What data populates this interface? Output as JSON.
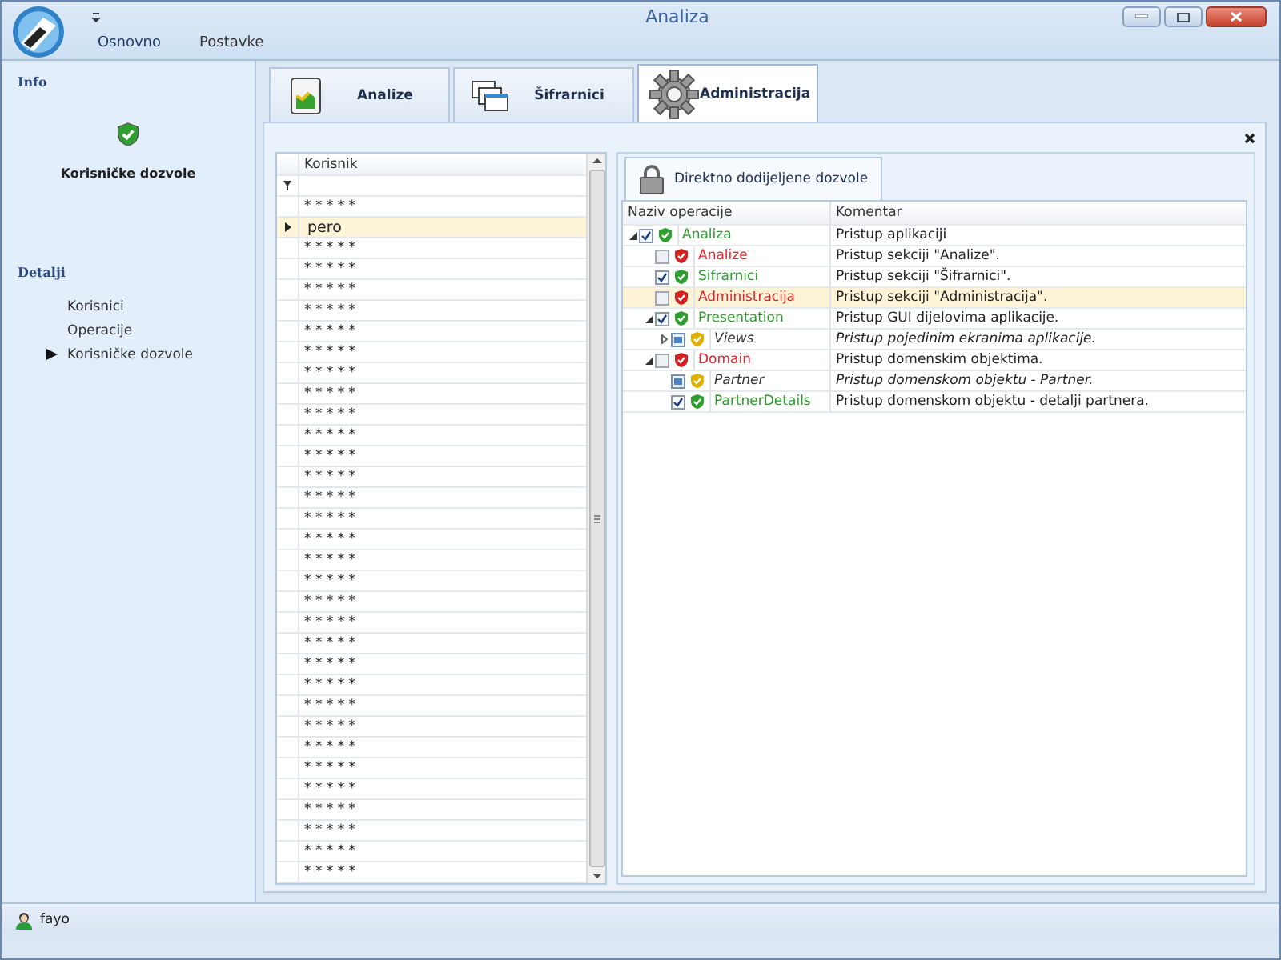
{
  "window": {
    "title": "Analiza"
  },
  "ribbon_tabs": [
    {
      "label": "Osnovno",
      "selected": true
    },
    {
      "label": "Postavke",
      "selected": false
    }
  ],
  "sidebar": {
    "info_heading": "Info",
    "info_label": "Korisničke dozvole",
    "details_heading": "Detalji",
    "items": [
      {
        "label": "Korisnici",
        "selected": false
      },
      {
        "label": "Operacije",
        "selected": false
      },
      {
        "label": "Korisničke dozvole",
        "selected": true
      }
    ]
  },
  "tabs": [
    {
      "label": "Analize",
      "kind": "analize",
      "selected": false
    },
    {
      "label": "Šifrarnici",
      "kind": "sifrarnici",
      "selected": false
    },
    {
      "label": "Administracija",
      "kind": "administracija",
      "selected": true
    }
  ],
  "users": {
    "column": "Korisnik",
    "rows": [
      {
        "name": "* * * * *",
        "selected": false
      },
      {
        "name": "pero",
        "selected": true
      },
      {
        "name": "* * * * *",
        "selected": false
      },
      {
        "name": "* * * * *",
        "selected": false
      },
      {
        "name": "* * * * *",
        "selected": false
      },
      {
        "name": "* * * * *",
        "selected": false
      },
      {
        "name": "* * * * *",
        "selected": false
      },
      {
        "name": "* * * * *",
        "selected": false
      },
      {
        "name": "* * * * *",
        "selected": false
      },
      {
        "name": "* * * * *",
        "selected": false
      },
      {
        "name": "* * * * *",
        "selected": false
      },
      {
        "name": "* * * * *",
        "selected": false
      },
      {
        "name": "* * * * *",
        "selected": false
      },
      {
        "name": "* * * * *",
        "selected": false
      },
      {
        "name": "* * * * *",
        "selected": false
      },
      {
        "name": "* * * * *",
        "selected": false
      },
      {
        "name": "* * * * *",
        "selected": false
      },
      {
        "name": "* * * * *",
        "selected": false
      },
      {
        "name": "* * * * *",
        "selected": false
      },
      {
        "name": "* * * * *",
        "selected": false
      },
      {
        "name": "* * * * *",
        "selected": false
      },
      {
        "name": "* * * * *",
        "selected": false
      },
      {
        "name": "* * * * *",
        "selected": false
      },
      {
        "name": "* * * * *",
        "selected": false
      },
      {
        "name": "* * * * *",
        "selected": false
      },
      {
        "name": "* * * * *",
        "selected": false
      },
      {
        "name": "* * * * *",
        "selected": false
      },
      {
        "name": "* * * * *",
        "selected": false
      },
      {
        "name": "* * * * *",
        "selected": false
      },
      {
        "name": "* * * * *",
        "selected": false
      },
      {
        "name": "* * * * *",
        "selected": false
      },
      {
        "name": "* * * * *",
        "selected": false
      },
      {
        "name": "* * * * *",
        "selected": false
      }
    ]
  },
  "permissions": {
    "tab": "Direktno dodijeljene dozvole",
    "columns": [
      "Naziv operacije",
      "Komentar"
    ],
    "nodes": [
      {
        "name": "Analiza",
        "comment": "Pristup aplikaciji",
        "checked": true,
        "kind": "allowed",
        "selected": false,
        "expanded": true,
        "children": [
          {
            "name": "Analize",
            "comment": "Pristup sekciji \"Analize\".",
            "checked": false,
            "kind": "denied",
            "selected": false
          },
          {
            "name": "Sifrarnici",
            "comment": "Pristup sekciji \"Šifrarnici\".",
            "checked": true,
            "kind": "allowed",
            "selected": false
          },
          {
            "name": "Administracija",
            "comment": "Pristup sekciji \"Administracija\".",
            "checked": false,
            "kind": "denied",
            "selected": true
          },
          {
            "name": "Presentation",
            "comment": "Pristup GUI dijelovima aplikacije.",
            "checked": true,
            "kind": "allowed",
            "selected": false,
            "expanded": true,
            "children": [
              {
                "name": "Views",
                "comment": "Pristup pojedinim ekranima aplikacije.",
                "kind": "partial",
                "selected": false,
                "expanded": false
              }
            ]
          },
          {
            "name": "Domain",
            "comment": "Pristup domenskim objektima.",
            "checked": false,
            "kind": "denied",
            "selected": false,
            "expanded": true,
            "children": [
              {
                "name": "Partner",
                "comment": "Pristup domenskom objektu - Partner.",
                "kind": "partial",
                "selected": false
              },
              {
                "name": "PartnerDetails",
                "comment": "Pristup domenskom objektu - detalji partnera.",
                "checked": true,
                "kind": "allowed",
                "selected": false
              }
            ]
          }
        ]
      }
    ]
  },
  "status_bar": {
    "user": "fayo"
  }
}
